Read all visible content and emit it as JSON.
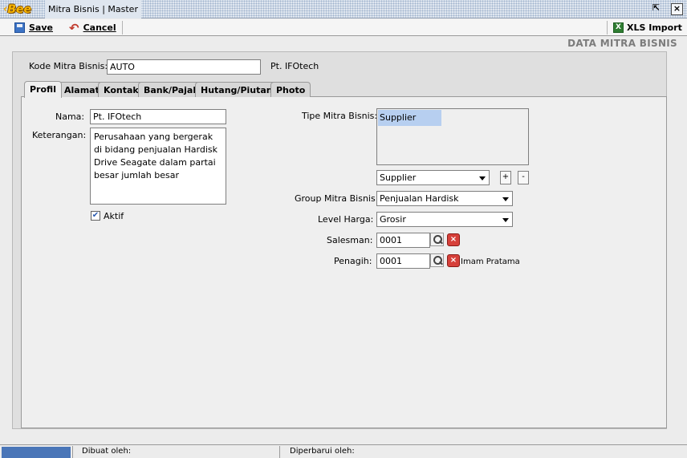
{
  "window": {
    "logo_text": "Bee",
    "title": "Mitra Bisnis | Master",
    "restore_glyph": "⇱",
    "close_glyph": "×"
  },
  "toolbar": {
    "save_label": "Save",
    "cancel_label": "Cancel",
    "xls_import_label": "XLS Import"
  },
  "section_title": "DATA MITRA BISNIS",
  "header": {
    "kode_label": "Kode Mitra Bisnis:",
    "kode_value": "AUTO",
    "company_name": "Pt. IFOtech"
  },
  "tabs": [
    {
      "label": "Profil"
    },
    {
      "label": "Alamat"
    },
    {
      "label": "Kontak"
    },
    {
      "label": "Bank/Pajak"
    },
    {
      "label": "Hutang/Piutang"
    },
    {
      "label": "Photo"
    }
  ],
  "profil": {
    "nama_label": "Nama:",
    "nama_value": "Pt. IFOtech",
    "keterangan_label": "Keterangan:",
    "keterangan_value": "Perusahaan yang bergerak di bidang penjualan Hardisk Drive Seagate dalam partai besar jumlah besar",
    "aktif_label": "Aktif",
    "aktif_checked": true,
    "tipe_label": "Tipe Mitra Bisnis:",
    "tipe_list": [
      "Supplier"
    ],
    "tipe_select": "Supplier",
    "add_label": "+",
    "remove_label": "-",
    "group_label": "Group Mitra Bisnis:",
    "group_value": "Penjualan Hardisk",
    "level_label": "Level Harga:",
    "level_value": "Grosir",
    "salesman_label": "Salesman:",
    "salesman_value": "0001",
    "salesman_name": "",
    "penagih_label": "Penagih:",
    "penagih_value": "0001",
    "penagih_name": "Imam Pratama"
  },
  "status": {
    "dibuat_label": "Dibuat oleh:",
    "diperbarui_label": "Diperbarui oleh:"
  },
  "icons": {
    "save": "save-icon",
    "cancel": "cancel-icon",
    "xls": "excel-icon",
    "search": "search-icon",
    "clear": "clear-icon"
  }
}
